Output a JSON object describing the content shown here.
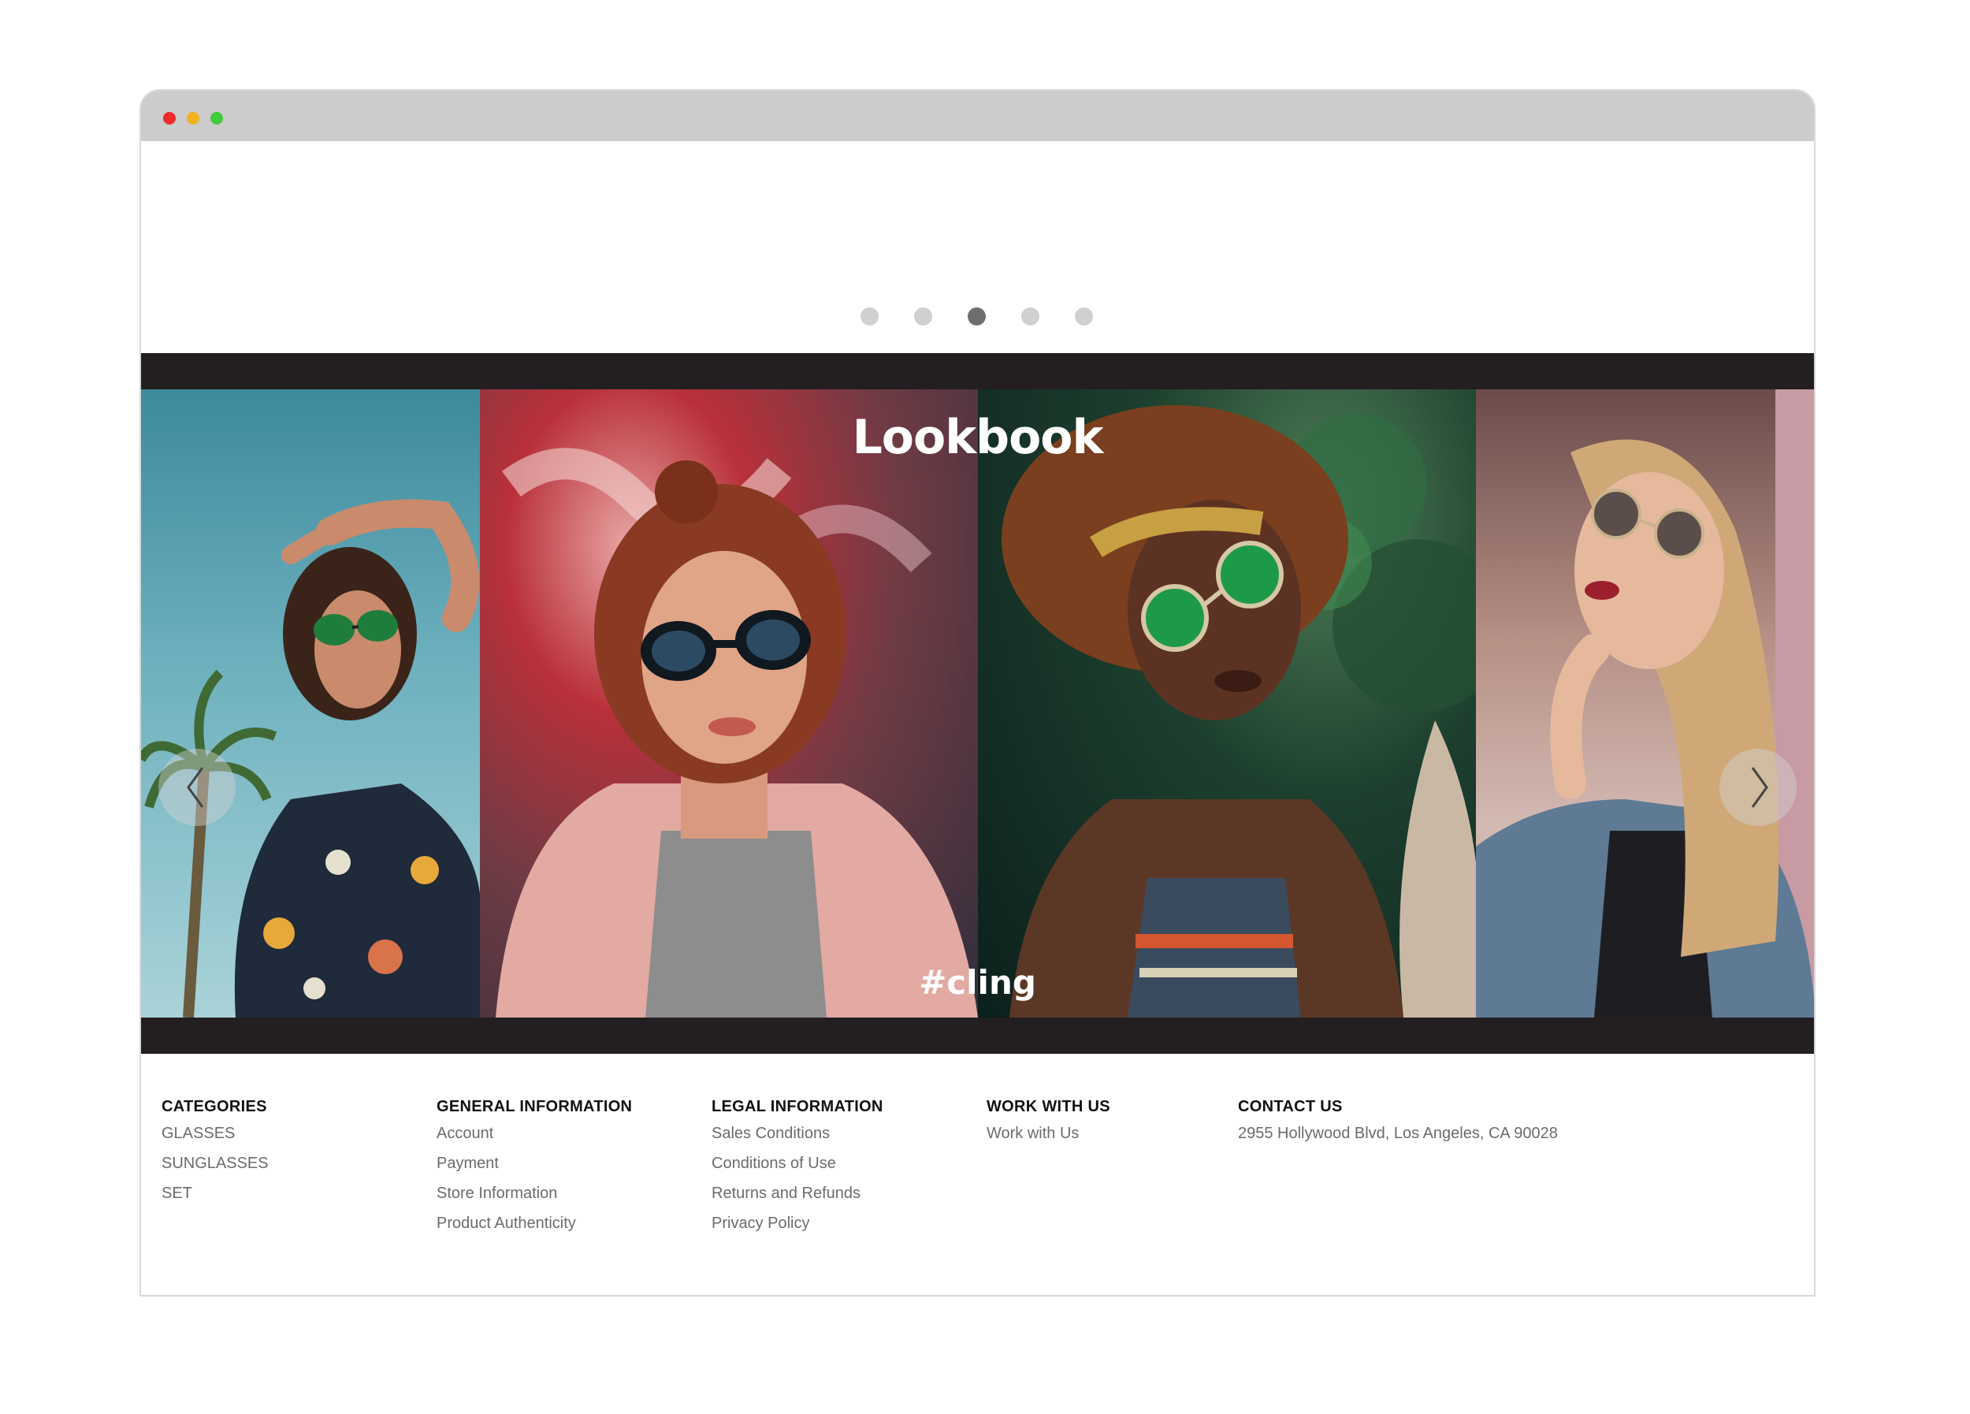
{
  "carousel": {
    "dots": [
      {
        "active": false
      },
      {
        "active": false
      },
      {
        "active": true
      },
      {
        "active": false
      },
      {
        "active": false
      }
    ]
  },
  "lookbook": {
    "title": "Lookbook",
    "hashtag": "#cling",
    "photos": [
      {
        "subject": "woman in floral shirt with green sunglasses under palm trees"
      },
      {
        "subject": "red-haired woman with round black sunglasses in pink jacket"
      },
      {
        "subject": "woman with curly hair and green mirrored sunglasses"
      },
      {
        "subject": "blonde woman with round sunglasses in denim jacket"
      }
    ]
  },
  "footer": {
    "categories": {
      "heading": "CATEGORIES",
      "links": [
        "GLASSES",
        "SUNGLASSES",
        "SET"
      ]
    },
    "general": {
      "heading": "GENERAL INFORMATION",
      "links": [
        "Account",
        "Payment",
        "Store Information",
        "Product Authenticity"
      ]
    },
    "legal": {
      "heading": "LEGAL INFORMATION",
      "links": [
        "Sales Conditions",
        "Conditions of Use",
        "Returns and Refunds",
        "Privacy Policy"
      ]
    },
    "work": {
      "heading": "WORK WITH US",
      "links": [
        "Work with Us"
      ]
    },
    "contact": {
      "heading": "CONTACT US",
      "address": "2955 Hollywood Blvd, Los Angeles, CA 90028"
    }
  },
  "colors": {
    "band": "#231f20",
    "dot_active": "#6e6e6e",
    "dot_inactive": "#d0d0d0",
    "titlebar": "#cccccc"
  }
}
